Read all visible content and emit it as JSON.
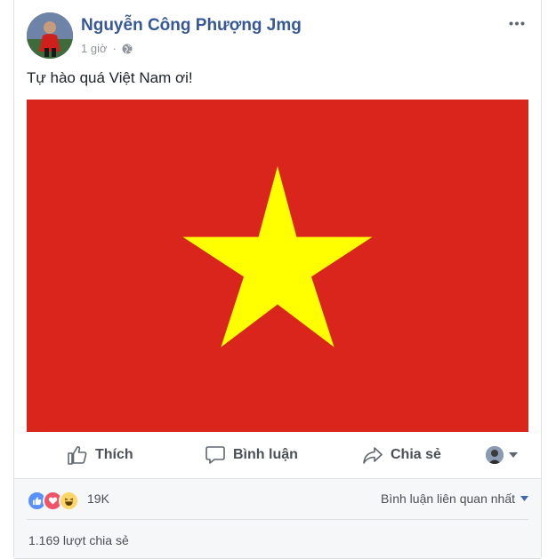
{
  "post": {
    "author": "Nguyễn Công Phượng Jmg",
    "time": "1 giờ",
    "audience_icon": "globe-icon",
    "text": "Tự hào quá Việt Nam ơi!",
    "image": {
      "subject": "vietnam-flag",
      "colors": {
        "field": "#da251d",
        "star": "#ffff00"
      }
    }
  },
  "actions": {
    "like": "Thích",
    "comment": "Bình luận",
    "share": "Chia sẻ"
  },
  "footer": {
    "reaction_count": "19K",
    "reactions": [
      "like-icon",
      "love-icon",
      "haha-icon"
    ],
    "sort_label": "Bình luận liên quan nhất",
    "shares": "1.169 lượt chia sẻ"
  },
  "colors": {
    "author": "#365899",
    "muted": "#90949c",
    "action_text": "#4b4f56",
    "footer_bg": "#f6f7f9",
    "like_blue": "#5890ff",
    "love_red": "#f25268",
    "haha_yellow": "#fcd669"
  }
}
